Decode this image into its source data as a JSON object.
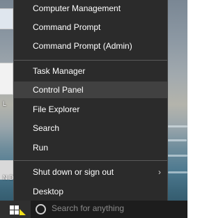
{
  "menu": {
    "items": [
      {
        "label": "Computer Management"
      },
      {
        "label": "Command Prompt"
      },
      {
        "label": "Command Prompt (Admin)"
      },
      {
        "label": "Task Manager"
      },
      {
        "label": "Control Panel",
        "highlighted": true
      },
      {
        "label": "File Explorer"
      },
      {
        "label": "Search"
      },
      {
        "label": "Run"
      },
      {
        "label": "Shut down or sign out",
        "has_submenu": true
      },
      {
        "label": "Desktop"
      }
    ],
    "submenu_icon": "chevron-right-icon"
  },
  "desktop": {
    "label_1": "L",
    "label_2": "N D"
  },
  "taskbar": {
    "start_icon": "windows-logo-icon",
    "search_icon": "search-circle-icon",
    "search_placeholder": "Search for anything"
  },
  "colors": {
    "menu_bg": "#2b2b2b",
    "menu_highlight": "#414141",
    "menu_text": "#ffffff",
    "taskbar_bg": "#1d1d1d"
  }
}
